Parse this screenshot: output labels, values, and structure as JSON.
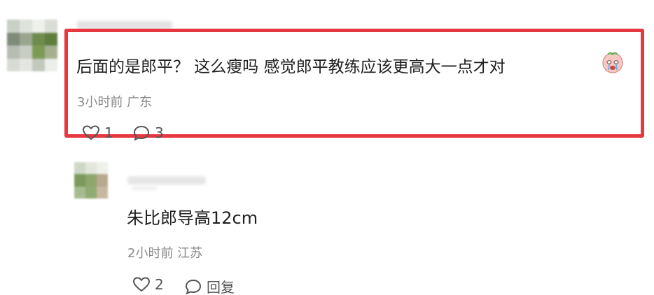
{
  "comments": [
    {
      "text": "后面的是郎平？ 这么瘦吗 感觉郎平教练应该更高大一点才对",
      "meta": "3小时前 广东",
      "likes": "1",
      "replies": "3"
    },
    {
      "text": "朱比郎导高12cm",
      "meta": "2小时前 江苏",
      "likes": "2",
      "reply_label": "回复"
    }
  ],
  "colors": {
    "highlight": "#e7383f",
    "meta_text": "#8a8a8a",
    "body_text": "#1f1f1f"
  },
  "icons": [
    "heart-icon",
    "comment-bubble-icon",
    "crying-face-emoji"
  ]
}
